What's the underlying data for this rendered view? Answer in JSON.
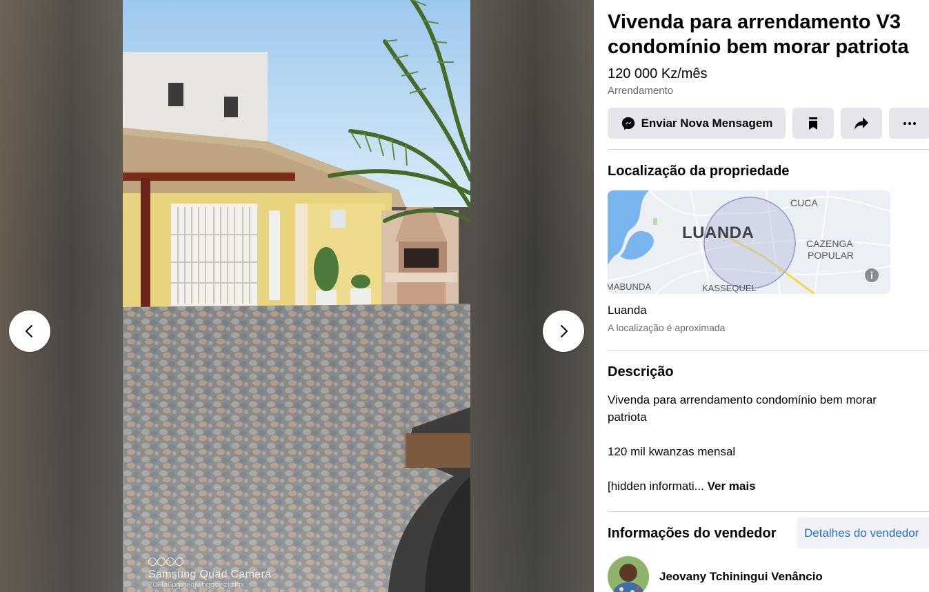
{
  "viewer": {
    "watermark": {
      "title": "Samsung Quad Camera",
      "subtitle": "Z0Fla6pgigeqjwhggcyjzljzlhx"
    },
    "prev_icon": "chevron-left-icon",
    "next_icon": "chevron-right-icon"
  },
  "listing": {
    "title": "Vivenda para arrendamento V3 condomínio bem morar patriota",
    "price": "120 000 Kz/mês",
    "type": "Arrendamento"
  },
  "actions": {
    "message_label": "Enviar Nova Mensagem",
    "message_icon": "messenger-icon",
    "save_icon": "bookmark-icon",
    "share_icon": "share-arrow-icon",
    "more_icon": "more-dots-icon"
  },
  "location": {
    "heading": "Localização da propriedade",
    "map_labels": {
      "city": "LUANDA",
      "north": "CUCA",
      "east": "CAZENGA POPULAR",
      "east_line1": "CAZENGA",
      "east_line2": "POPULAR",
      "southwest": "MABUNDA",
      "south": "KASSEQUEL"
    },
    "name": "Luanda",
    "note": "A localização é aproximada"
  },
  "description": {
    "heading": "Descrição",
    "line1": "Vivenda para arrendamento condomínio bem morar patriota",
    "line2": "120 mil kwanzas mensal",
    "line3": "[hidden informati...",
    "see_more": "Ver mais"
  },
  "seller": {
    "heading": "Informações do vendedor",
    "details_button": "Detalhes do vendedor",
    "name": "Jeovany Tchiningui Venâncio"
  },
  "colors": {
    "button_bg": "#e4e6eb",
    "link_blue": "#216fdb",
    "secondary_text": "#65676b",
    "divider": "#ced0d4"
  }
}
